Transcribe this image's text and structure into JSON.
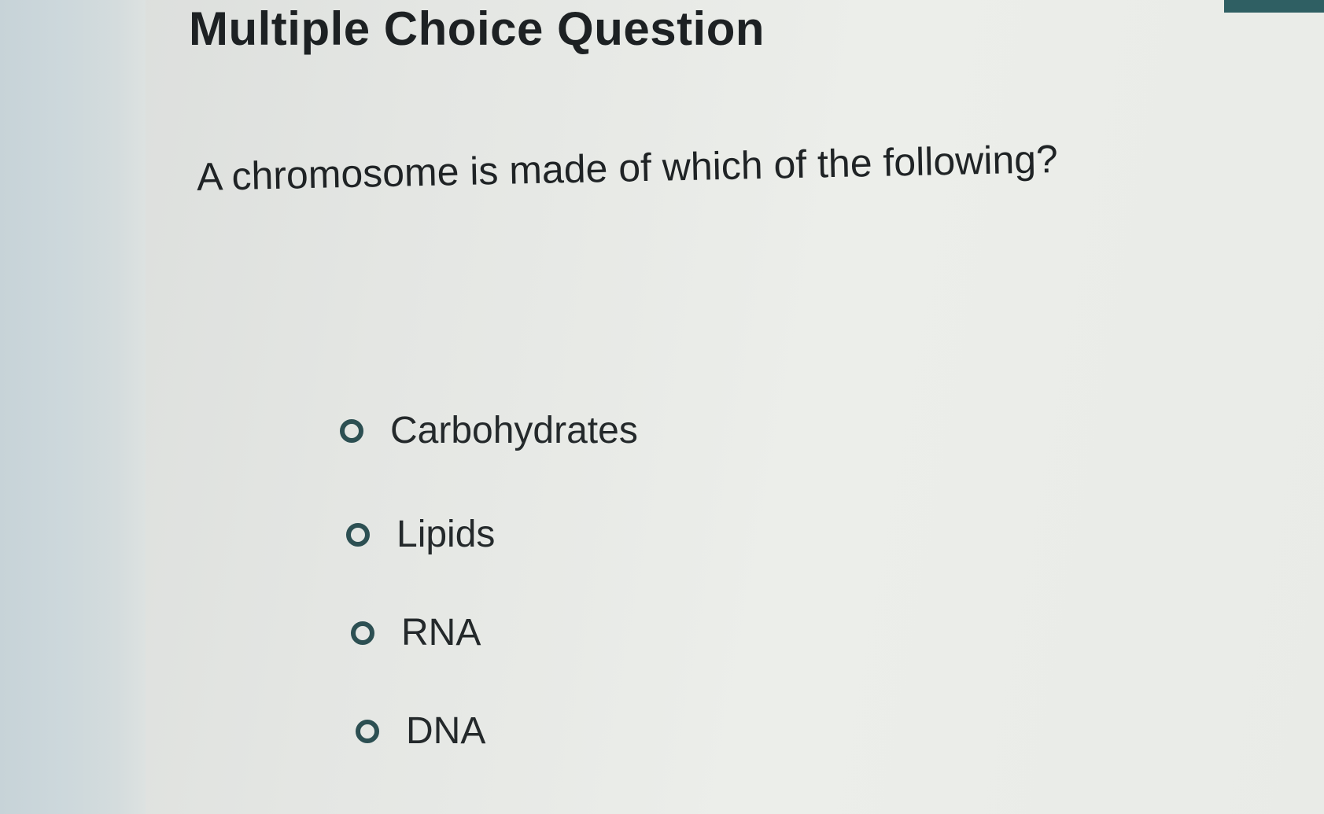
{
  "page": {
    "title": "Multiple Choice Question"
  },
  "question": {
    "text": "A chromosome is made of which of the following?",
    "options": [
      {
        "label": "Carbohydrates",
        "selected": false
      },
      {
        "label": "Lipids",
        "selected": false
      },
      {
        "label": "RNA",
        "selected": false
      },
      {
        "label": "DNA",
        "selected": false
      }
    ]
  },
  "colors": {
    "accent": "#2f5f63",
    "radio_border": "#2c4f52",
    "text": "#1f2325"
  }
}
